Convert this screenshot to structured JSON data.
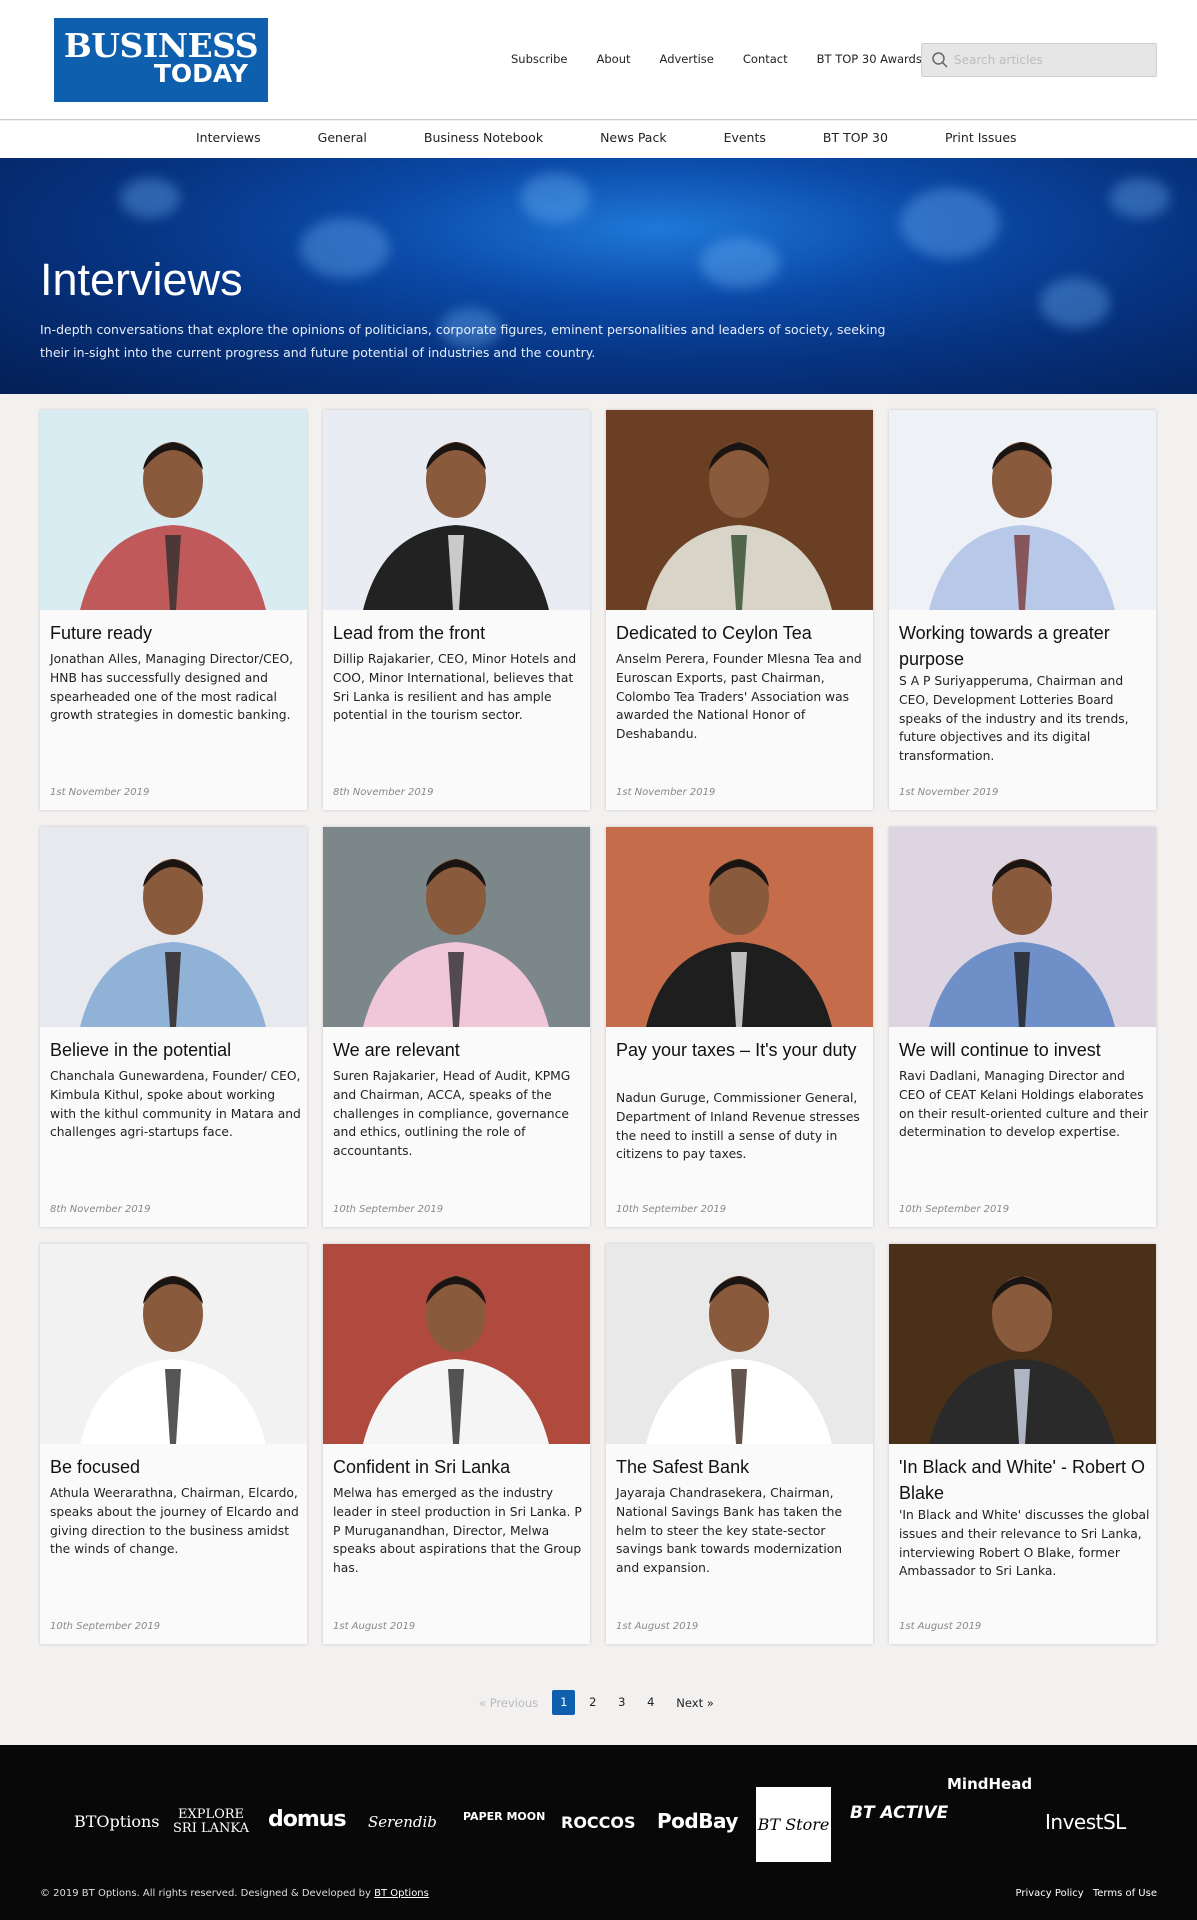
{
  "logo": {
    "line1": "BUSINESS",
    "line2": "TODAY"
  },
  "top_nav": [
    "Subscribe",
    "About",
    "Advertise",
    "Contact",
    "BT TOP 30 Awards"
  ],
  "search": {
    "placeholder": "Search articles"
  },
  "main_nav": [
    "Interviews",
    "General",
    "Business Notebook",
    "News Pack",
    "Events",
    "BT TOP 30",
    "Print Issues"
  ],
  "hero": {
    "title": "Interviews",
    "description": "In-depth conversations that explore the opinions of politicians, corporate figures, eminent personalities and leaders of society, seeking their in-sight into the current progress and future potential of industries and the country."
  },
  "articles": [
    {
      "title": "Future ready",
      "description": "Jonathan Alles, Managing Director/CEO, HNB has successfully designed and spearheaded one of the most radical growth strategies in domestic banking.",
      "date": "1st November 2019"
    },
    {
      "title": "Lead from the front",
      "description": "Dillip Rajakarier, CEO, Minor Hotels and COO, Minor International, believes that Sri Lanka is resilient and has ample potential in the tourism sector.",
      "date": "8th November 2019"
    },
    {
      "title": "Dedicated to Ceylon Tea",
      "description": "Anselm Perera, Founder Mlesna Tea and Euroscan Exports, past Chairman, Colombo Tea Traders' Association was awarded the National Honor of Deshabandu.",
      "date": "1st November 2019"
    },
    {
      "title": "Working towards a greater purpose",
      "description": "S A P Suriyapperuma, Chairman and CEO, Development Lotteries Board speaks of the industry and its trends, future objectives and its digital transformation.",
      "date": "1st November 2019"
    },
    {
      "title": "Believe in the potential",
      "description": "Chanchala Gunewardena, Founder/ CEO, Kimbula Kithul, spoke about working with the kithul community in Matara and challenges agri-startups face.",
      "date": "8th November 2019"
    },
    {
      "title": "We are relevant",
      "description": "Suren Rajakarier, Head of Audit, KPMG and Chairman, ACCA, speaks of the challenges in compliance, governance and ethics, outlining the role of accountants.",
      "date": "10th September 2019"
    },
    {
      "title": "Pay your taxes – It's your duty",
      "description": "Nadun Guruge, Commissioner General, Department of Inland Revenue stresses the need to instill a sense of duty in citizens to pay taxes.",
      "date": "10th September 2019"
    },
    {
      "title": "We will continue to invest",
      "description": "Ravi Dadlani, Managing Director and CEO of CEAT Kelani Holdings elaborates on their result-oriented culture and their determination to develop expertise.",
      "date": "10th September 2019"
    },
    {
      "title": "Be focused",
      "description": "Athula Weerarathna, Chairman, Elcardo, speaks about the journey of Elcardo and giving direction to the business amidst the winds of change.",
      "date": "10th September 2019"
    },
    {
      "title": "Confident in Sri Lanka",
      "description": "Melwa has emerged as the industry leader in steel production in Sri Lanka. P P Muruganandhan, Director, Melwa speaks about aspirations that the Group has.",
      "date": "1st August 2019"
    },
    {
      "title": "The Safest Bank",
      "description": "Jayaraja Chandrasekera, Chairman, National Savings Bank has taken the helm to steer the key state-sector savings bank towards modernization and expansion.",
      "date": "1st August 2019"
    },
    {
      "title": "'In Black and White' - Robert O Blake",
      "description": "'In Black and White' discusses the global issues and their relevance to Sri Lanka, interviewing Robert O Blake, former Ambassador to Sri Lanka.",
      "date": "1st August 2019"
    }
  ],
  "pagination": {
    "previous": "«  Previous",
    "pages": [
      "1",
      "2",
      "3",
      "4"
    ],
    "current": "1",
    "next": "Next  »"
  },
  "footer": {
    "brands": [
      "BTOptions",
      "EXPLORE SRI LANKA",
      "domus",
      "Serendib",
      "PAPER MOON",
      "ROCCOS",
      "PodBay",
      "BT Store",
      "BT ACTIVE",
      "MindHead",
      "InvestSL"
    ],
    "copyright_text": "© 2019 BT Options. All rights reserved. Designed & Developed by ",
    "copyright_link": "BT Options",
    "links": [
      "Privacy Policy",
      "Terms of Use"
    ]
  }
}
